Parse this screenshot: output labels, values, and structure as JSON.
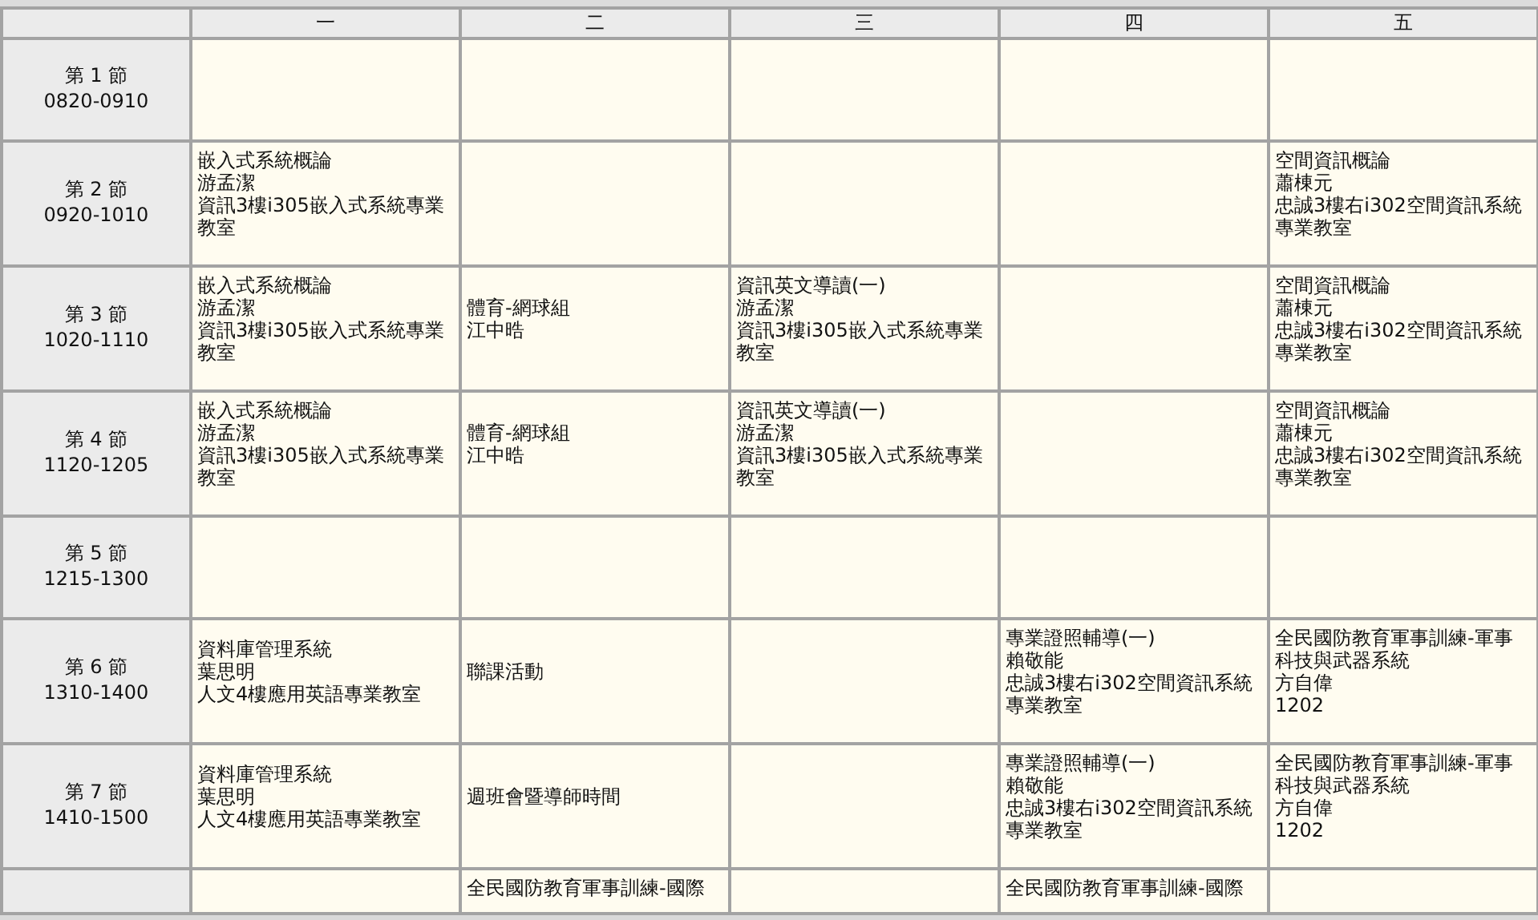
{
  "days": [
    "一",
    "二",
    "三",
    "四",
    "五"
  ],
  "periods": [
    {
      "label": "第 1 節",
      "time": "0820-0910",
      "cells": [
        null,
        null,
        null,
        null,
        null
      ]
    },
    {
      "label": "第 2 節",
      "time": "0920-1010",
      "cells": [
        [
          "嵌入式系統概論",
          "游孟潔",
          "資訊3樓i305嵌入式系統專業教室"
        ],
        null,
        null,
        null,
        [
          "空間資訊概論",
          "蕭棟元",
          "忠誠3樓右i302空間資訊系統專業教室"
        ]
      ]
    },
    {
      "label": "第 3 節",
      "time": "1020-1110",
      "cells": [
        [
          "嵌入式系統概論",
          "游孟潔",
          "資訊3樓i305嵌入式系統專業教室"
        ],
        [
          "體育-網球組",
          "江中晧"
        ],
        [
          "資訊英文導讀(一)",
          "游孟潔",
          "資訊3樓i305嵌入式系統專業教室"
        ],
        null,
        [
          "空間資訊概論",
          "蕭棟元",
          "忠誠3樓右i302空間資訊系統專業教室"
        ]
      ]
    },
    {
      "label": "第 4 節",
      "time": "1120-1205",
      "cells": [
        [
          "嵌入式系統概論",
          "游孟潔",
          "資訊3樓i305嵌入式系統專業教室"
        ],
        [
          "體育-網球組",
          "江中晧"
        ],
        [
          "資訊英文導讀(一)",
          "游孟潔",
          "資訊3樓i305嵌入式系統專業教室"
        ],
        null,
        [
          "空間資訊概論",
          "蕭棟元",
          "忠誠3樓右i302空間資訊系統專業教室"
        ]
      ]
    },
    {
      "label": "第 5 節",
      "time": "1215-1300",
      "cells": [
        null,
        null,
        null,
        null,
        null
      ]
    },
    {
      "label": "第 6 節",
      "time": "1310-1400",
      "cells": [
        [
          "資料庫管理系統",
          "葉思明",
          "人文4樓應用英語專業教室"
        ],
        [
          "聯課活動"
        ],
        null,
        [
          "專業證照輔導(一)",
          "賴敬能",
          "忠誠3樓右i302空間資訊系統專業教室"
        ],
        [
          "全民國防教育軍事訓練-軍事科技與武器系統",
          "方自偉",
          "1202"
        ]
      ]
    },
    {
      "label": "第 7 節",
      "time": "1410-1500",
      "cells": [
        [
          "資料庫管理系統",
          "葉思明",
          "人文4樓應用英語專業教室"
        ],
        [
          "週班會暨導師時間"
        ],
        null,
        [
          "專業證照輔導(一)",
          "賴敬能",
          "忠誠3樓右i302空間資訊系統專業教室"
        ],
        [
          "全民國防教育軍事訓練-軍事科技與武器系統",
          "方自偉",
          "1202"
        ]
      ]
    },
    {
      "cells": [
        null,
        [
          "全民國防教育軍事訓練-國際"
        ],
        null,
        [
          "全民國防教育軍事訓練-國際"
        ],
        null
      ]
    }
  ]
}
